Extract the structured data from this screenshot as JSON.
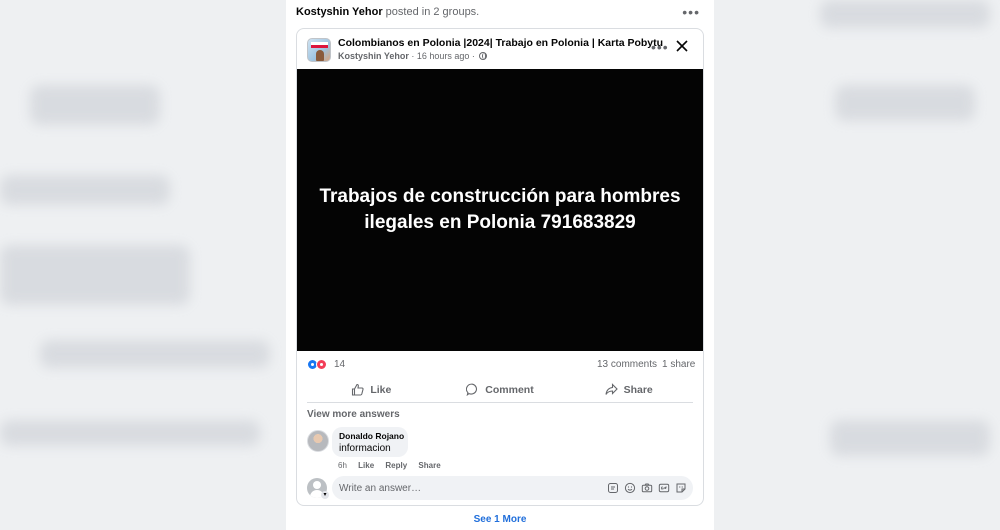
{
  "post": {
    "poster_name": "Kostyshin Yehor",
    "poster_action": "posted in 2 groups.",
    "more_icon": "ellipsis-icon"
  },
  "card": {
    "group_name": "Colombianos en Polonia |2024| Trabajo en Polonia | Karta Pobytu",
    "author": "Kostyshin Yehor",
    "time": "· 16 hours ago ·",
    "media_text": "Trabajos de construcción para hombres ilegales en Polonia 791683829",
    "media_bg": "#040404"
  },
  "stats": {
    "reactions_count": "14",
    "comments": "13 comments",
    "shares": "1 share",
    "like_color": "#1877f2",
    "love_color": "#f33e58"
  },
  "actions": {
    "like": "Like",
    "comment": "Comment",
    "share": "Share"
  },
  "comments_section": {
    "view_more": "View more answers",
    "comment": {
      "author": "Donaldo Rojano",
      "text": "informacion",
      "time": "6h",
      "like": "Like",
      "reply": "Reply",
      "share": "Share"
    },
    "reply_placeholder": "Write an answer…",
    "reply_icons": [
      "sticker-icon",
      "emoji-icon",
      "camera-icon",
      "gif-icon",
      "avatar-sticker-icon"
    ]
  },
  "footer": {
    "see_more": "See 1 More",
    "link_color": "#216fdb"
  }
}
